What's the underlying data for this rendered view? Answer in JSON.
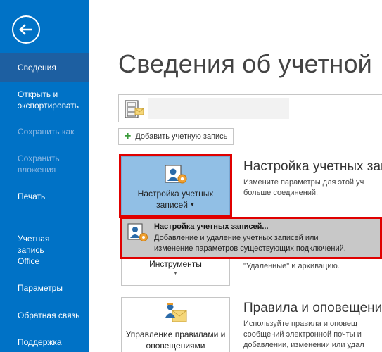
{
  "sidebar": {
    "items": [
      {
        "label": "Сведения"
      },
      {
        "label": "Открыть и экспортировать"
      },
      {
        "label": "Сохранить как"
      },
      {
        "label": "Сохранить вложения"
      },
      {
        "label": "Печать"
      },
      {
        "label": "Учетная запись Office"
      },
      {
        "label": "Параметры"
      },
      {
        "label": "Обратная связь"
      },
      {
        "label": "Поддержка"
      }
    ]
  },
  "main": {
    "title": "Сведения об учетной",
    "add_account_label": "Добавить учетную запись",
    "account_settings": {
      "button_label": "Настройка учетных записей",
      "heading": "Настройка учетных запи",
      "desc_line1": "Измените параметры для этой уч",
      "desc_line2": "больше соединений."
    },
    "dropdown": {
      "title": "Настройка учетных записей...",
      "desc_line1": "Добавление и удаление учетных записей или",
      "desc_line2": "изменение параметров существующих подключений."
    },
    "tools": {
      "button_label": "Инструменты",
      "desc_line": "\"Удаленные\" и архивацию."
    },
    "rules": {
      "button_label": "Управление правилами и оповещениями",
      "heading": "Правила и оповещени",
      "desc_line1": "Используйте правила и оповещ",
      "desc_line2": "сообщений электронной почты и",
      "desc_line3": "добавлении, изменении или удал"
    }
  },
  "colors": {
    "sidebar_bg": "#0072c6",
    "sidebar_active": "#1d5fa1",
    "selected_button": "#91bfe5",
    "highlight_frame": "#e00000"
  }
}
